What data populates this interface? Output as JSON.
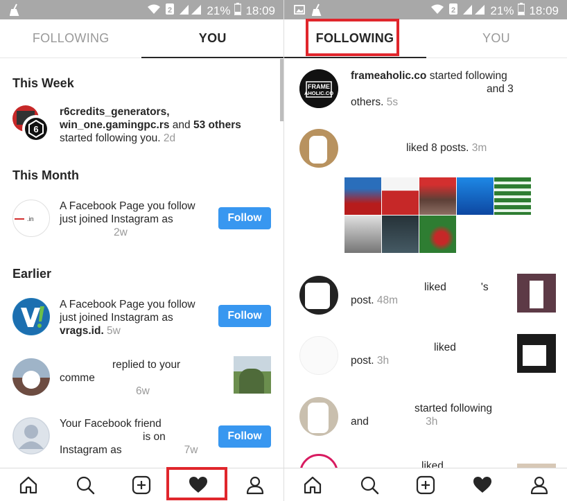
{
  "status_bar": {
    "battery": "21%",
    "time": "18:09"
  },
  "left": {
    "tabs": [
      {
        "label": "FOLLOWING"
      },
      {
        "label": "YOU"
      }
    ],
    "sections": [
      "This Week",
      "This Month",
      "Earlier"
    ],
    "items": [
      {
        "line1": "r6credits_generators,",
        "line2a": "win_one.gamingpc.rs",
        "line2b": " and ",
        "line2c": "53 others",
        "line3": "started following you.",
        "time": " 2d"
      },
      {
        "line1": "A Facebook Page you follow",
        "line2": "just joined Instagram as",
        "time": "2w",
        "button": "Follow"
      },
      {
        "line1": "A Facebook Page you follow",
        "line2": "just joined Instagram as",
        "line3b": "vrags.id.",
        "time": " 5w",
        "button": "Follow"
      },
      {
        "line1": "replied to your",
        "line2": "comme",
        "time": "6w"
      },
      {
        "line1": "Your Facebook friend",
        "line2": "is on",
        "line3": "Instagram as",
        "time": "7w",
        "button": "Follow"
      }
    ]
  },
  "right": {
    "tabs": [
      {
        "label": "FOLLOWING"
      },
      {
        "label": "YOU"
      }
    ],
    "items": [
      {
        "user": "frameaholic.co",
        "text": " started following",
        "tail": "and 3",
        "line3": "others.",
        "time": " 5s",
        "avatar_text": "FRAME AHOLIC.CO"
      },
      {
        "text": "liked 8 posts.",
        "time": " 3m"
      },
      {
        "text": "liked",
        "tail": "'s",
        "line2": "post.",
        "time": " 48m"
      },
      {
        "text": "liked",
        "line2": "post.",
        "time": " 3h"
      },
      {
        "text": "started following",
        "line2": "and",
        "time": " 3h"
      },
      {
        "text": "liked"
      }
    ]
  },
  "nav_icons": [
    "home-icon",
    "search-icon",
    "add-post-icon",
    "heart-icon",
    "profile-icon"
  ],
  "colors": {
    "accent": "#3897f0",
    "highlight": "#e0262c",
    "status_bar": "#a8a8a8"
  }
}
